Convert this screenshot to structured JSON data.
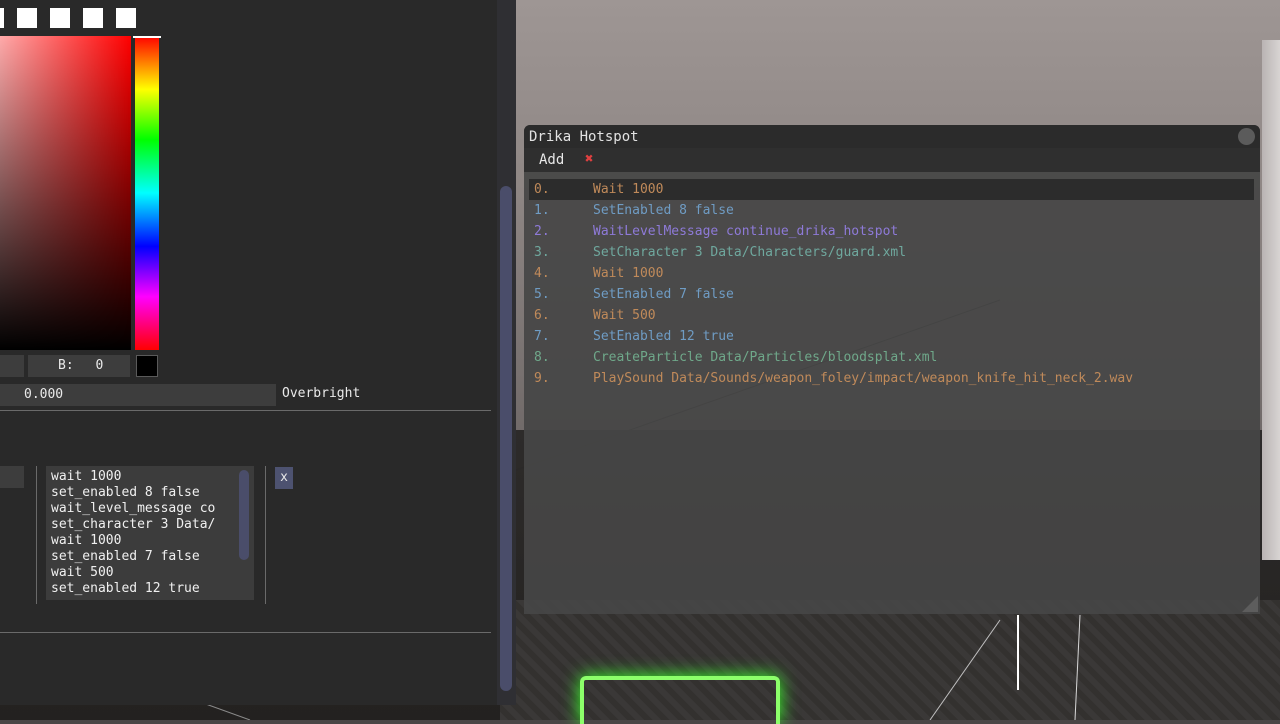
{
  "left_panel": {
    "color_picker": {
      "channel_b_label": "B:",
      "channel_b_value": "0",
      "overbright_value": "0.000",
      "overbright_label": "Overbright"
    },
    "script_lines": [
      "wait 1000",
      "set_enabled 8 false",
      "wait_level_message co",
      "set_character 3 Data/",
      "wait 1000",
      "set_enabled 7 false",
      "wait 500",
      "set_enabled 12 true"
    ],
    "close_button_label": "x"
  },
  "hotspot_window": {
    "title": "Drika Hotspot",
    "menu": {
      "add_label": "Add",
      "remove_label": "✖"
    },
    "actions": [
      {
        "index": "0.",
        "text": "Wait 1000",
        "color": "#c08a5a",
        "selected": true
      },
      {
        "index": "1.",
        "text": "SetEnabled 8 false",
        "color": "#6f9cc4"
      },
      {
        "index": "2.",
        "text": "WaitLevelMessage continue_drika_hotspot",
        "color": "#8e7ad8"
      },
      {
        "index": "3.",
        "text": "SetCharacter 3 Data/Characters/guard.xml",
        "color": "#6fa89e"
      },
      {
        "index": "4.",
        "text": "Wait 1000",
        "color": "#c08a5a"
      },
      {
        "index": "5.",
        "text": "SetEnabled 7 false",
        "color": "#6f9cc4"
      },
      {
        "index": "6.",
        "text": "Wait 500",
        "color": "#c08a5a"
      },
      {
        "index": "7.",
        "text": "SetEnabled 12 true",
        "color": "#6f9cc4"
      },
      {
        "index": "8.",
        "text": "CreateParticle Data/Particles/bloodsplat.xml",
        "color": "#6fa88a"
      },
      {
        "index": "9.",
        "text": "PlaySound Data/Sounds/weapon_foley/impact/weapon_knife_hit_neck_2.wav",
        "color": "#c08a5a"
      }
    ]
  },
  "colors": {
    "panel_bg": "#292929",
    "window_bg": "#464646",
    "accent_scroll": "#4a4d6a",
    "remove_red": "#e04040"
  }
}
